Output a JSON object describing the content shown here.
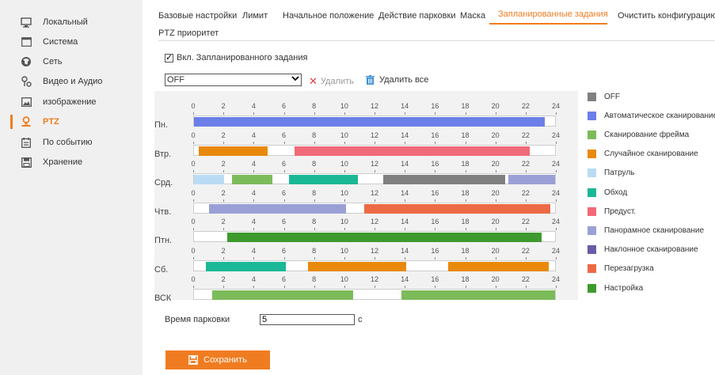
{
  "sidebar": {
    "items": [
      {
        "label": "Локальный",
        "icon": "monitor-icon"
      },
      {
        "label": "Система",
        "icon": "system-icon"
      },
      {
        "label": "Сеть",
        "icon": "globe-icon"
      },
      {
        "label": "Видео и Аудио",
        "icon": "video-audio-icon"
      },
      {
        "label": "изображение",
        "icon": "image-icon"
      },
      {
        "label": "PTZ",
        "icon": "ptz-icon",
        "active": true
      },
      {
        "label": "По событию",
        "icon": "event-icon"
      },
      {
        "label": "Хранение",
        "icon": "storage-icon"
      }
    ]
  },
  "tabs": [
    {
      "label": "Базовые настройки"
    },
    {
      "label": "Лимит"
    },
    {
      "label": "Начальное положение"
    },
    {
      "label": "Действие парковки"
    },
    {
      "label": "Маска"
    },
    {
      "label": "Запланированные задания",
      "active": true
    },
    {
      "label": "Очистить конфигурацию"
    },
    {
      "label": "PTZ приоритет"
    }
  ],
  "enable": {
    "label": "Вкл. Запланированного задания",
    "checked": true
  },
  "task_select": {
    "value": "OFF"
  },
  "delete_label": "Удалить",
  "delete_all_label": "Удалить все",
  "hours": [
    "0",
    "2",
    "4",
    "6",
    "8",
    "10",
    "12",
    "14",
    "16",
    "18",
    "20",
    "22",
    "24"
  ],
  "schedule": [
    {
      "day": "Пн.",
      "segments": [
        {
          "start": 0,
          "end": 23.3,
          "task": "auto"
        }
      ]
    },
    {
      "day": "Втр.",
      "segments": [
        {
          "start": 0.3,
          "end": 4.9,
          "task": "random"
        },
        {
          "start": 6.7,
          "end": 22.3,
          "task": "preset"
        }
      ]
    },
    {
      "day": "Срд.",
      "segments": [
        {
          "start": 0,
          "end": 2,
          "task": "patrol"
        },
        {
          "start": 2.5,
          "end": 5.2,
          "task": "frame"
        },
        {
          "start": 6.3,
          "end": 10.9,
          "task": "tour"
        },
        {
          "start": 12.6,
          "end": 20.7,
          "task": "gray"
        },
        {
          "start": 20.9,
          "end": 24,
          "task": "pano"
        }
      ]
    },
    {
      "day": "Чтв.",
      "segments": [
        {
          "start": 1,
          "end": 10.1,
          "task": "pano"
        },
        {
          "start": 11.3,
          "end": 23.7,
          "task": "reboot"
        }
      ]
    },
    {
      "day": "Птн.",
      "segments": [
        {
          "start": 2.2,
          "end": 23.1,
          "task": "setup"
        }
      ]
    },
    {
      "day": "Сб.",
      "segments": [
        {
          "start": 0.8,
          "end": 6.1,
          "task": "tour"
        },
        {
          "start": 7.6,
          "end": 14.1,
          "task": "random"
        },
        {
          "start": 16.9,
          "end": 23.6,
          "task": "random"
        }
      ]
    },
    {
      "day": "ВСК",
      "segments": [
        {
          "start": 1.2,
          "end": 10.6,
          "task": "frame"
        },
        {
          "start": 13.8,
          "end": 24,
          "task": "frame"
        }
      ]
    }
  ],
  "legend": [
    {
      "key": "gray",
      "label": "OFF",
      "color": "#808080"
    },
    {
      "key": "auto",
      "label": "Автоматическое сканирование",
      "color": "#6c7fe8"
    },
    {
      "key": "frame",
      "label": "Сканирование фрейма",
      "color": "#7cbb5a"
    },
    {
      "key": "random",
      "label": "Случайное сканирование",
      "color": "#e8890c"
    },
    {
      "key": "patrol",
      "label": "Патруль",
      "color": "#b9dcf4"
    },
    {
      "key": "tour",
      "label": "Обход",
      "color": "#1bb896"
    },
    {
      "key": "preset",
      "label": "Предуст.",
      "color": "#f06a78"
    },
    {
      "key": "pano",
      "label": "Панорамное сканирование",
      "color": "#9aa0d6"
    },
    {
      "key": "tilt",
      "label": "Наклонное сканирование",
      "color": "#6b5aa6"
    },
    {
      "key": "reboot",
      "label": "Перезагрузка",
      "color": "#ec6a45"
    },
    {
      "key": "setup",
      "label": "Настройка",
      "color": "#3e9a2e"
    }
  ],
  "park": {
    "label": "Время парковки",
    "value": "5",
    "unit": "с"
  },
  "save_label": "Сохранить",
  "colors": {
    "accent": "#f07c21"
  }
}
